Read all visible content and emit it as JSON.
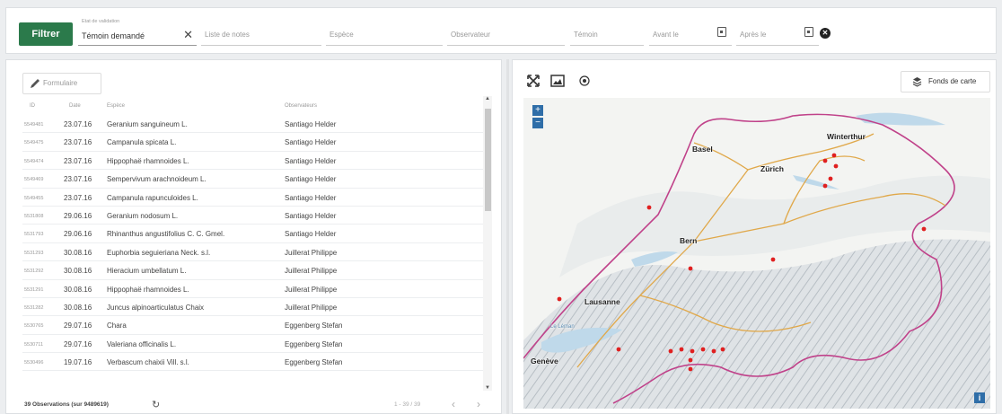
{
  "filterbar": {
    "filter_button": "Filtrer",
    "validation_state": {
      "label": "Etat de validation",
      "value": "Témoin demandé"
    },
    "notes_placeholder": "Liste de notes",
    "species_placeholder": "Espèce",
    "observer_placeholder": "Observateur",
    "voucher_placeholder": "Témoin",
    "before_placeholder": "Avant le",
    "after_placeholder": "Après le"
  },
  "form_button": "Formulaire",
  "table": {
    "headers": {
      "id": "ID",
      "date": "Date",
      "species": "Espèce",
      "observers": "Observateurs"
    },
    "rows": [
      {
        "id": "5549481",
        "date": "23.07.16",
        "species": "Geranium sanguineum L.",
        "observer": "Santiago Helder"
      },
      {
        "id": "5549475",
        "date": "23.07.16",
        "species": "Campanula spicata L.",
        "observer": "Santiago Helder"
      },
      {
        "id": "5549474",
        "date": "23.07.16",
        "species": "Hippophaë rhamnoides L.",
        "observer": "Santiago Helder"
      },
      {
        "id": "5549469",
        "date": "23.07.16",
        "species": "Sempervivum arachnoideum L.",
        "observer": "Santiago Helder"
      },
      {
        "id": "5549455",
        "date": "23.07.16",
        "species": "Campanula rapunculoides L.",
        "observer": "Santiago Helder"
      },
      {
        "id": "5531808",
        "date": "29.06.16",
        "species": "Geranium nodosum L.",
        "observer": "Santiago Helder"
      },
      {
        "id": "5531793",
        "date": "29.06.16",
        "species": "Rhinanthus angustifolius C. C. Gmel.",
        "observer": "Santiago Helder"
      },
      {
        "id": "5531293",
        "date": "30.08.16",
        "species": "Euphorbia seguieriana Neck. s.l.",
        "observer": "Juillerat Philippe"
      },
      {
        "id": "5531292",
        "date": "30.08.16",
        "species": "Hieracium umbellatum L.",
        "observer": "Juillerat Philippe"
      },
      {
        "id": "5531291",
        "date": "30.08.16",
        "species": "Hippophaë rhamnoides L.",
        "observer": "Juillerat Philippe"
      },
      {
        "id": "5531282",
        "date": "30.08.16",
        "species": "Juncus alpinoarticulatus Chaix",
        "observer": "Juillerat Philippe"
      },
      {
        "id": "5530765",
        "date": "29.07.16",
        "species": "Chara",
        "observer": "Eggenberg Stefan"
      },
      {
        "id": "5530711",
        "date": "29.07.16",
        "species": "Valeriana officinalis L.",
        "observer": "Eggenberg Stefan"
      },
      {
        "id": "5530496",
        "date": "19.07.16",
        "species": "Verbascum chaixii Vill. s.l.",
        "observer": "Eggenberg Stefan"
      }
    ]
  },
  "footer": {
    "count": "39 Observations (sur 9489619)",
    "pagination": "1 - 39 / 39"
  },
  "map": {
    "basemap_button": "Fonds de carte",
    "cities": [
      "Basel",
      "Winterthur",
      "Zürich",
      "Bern",
      "Lausanne",
      "Genève"
    ],
    "lake_label": "Le Léman",
    "marker_color": "#e02020"
  }
}
